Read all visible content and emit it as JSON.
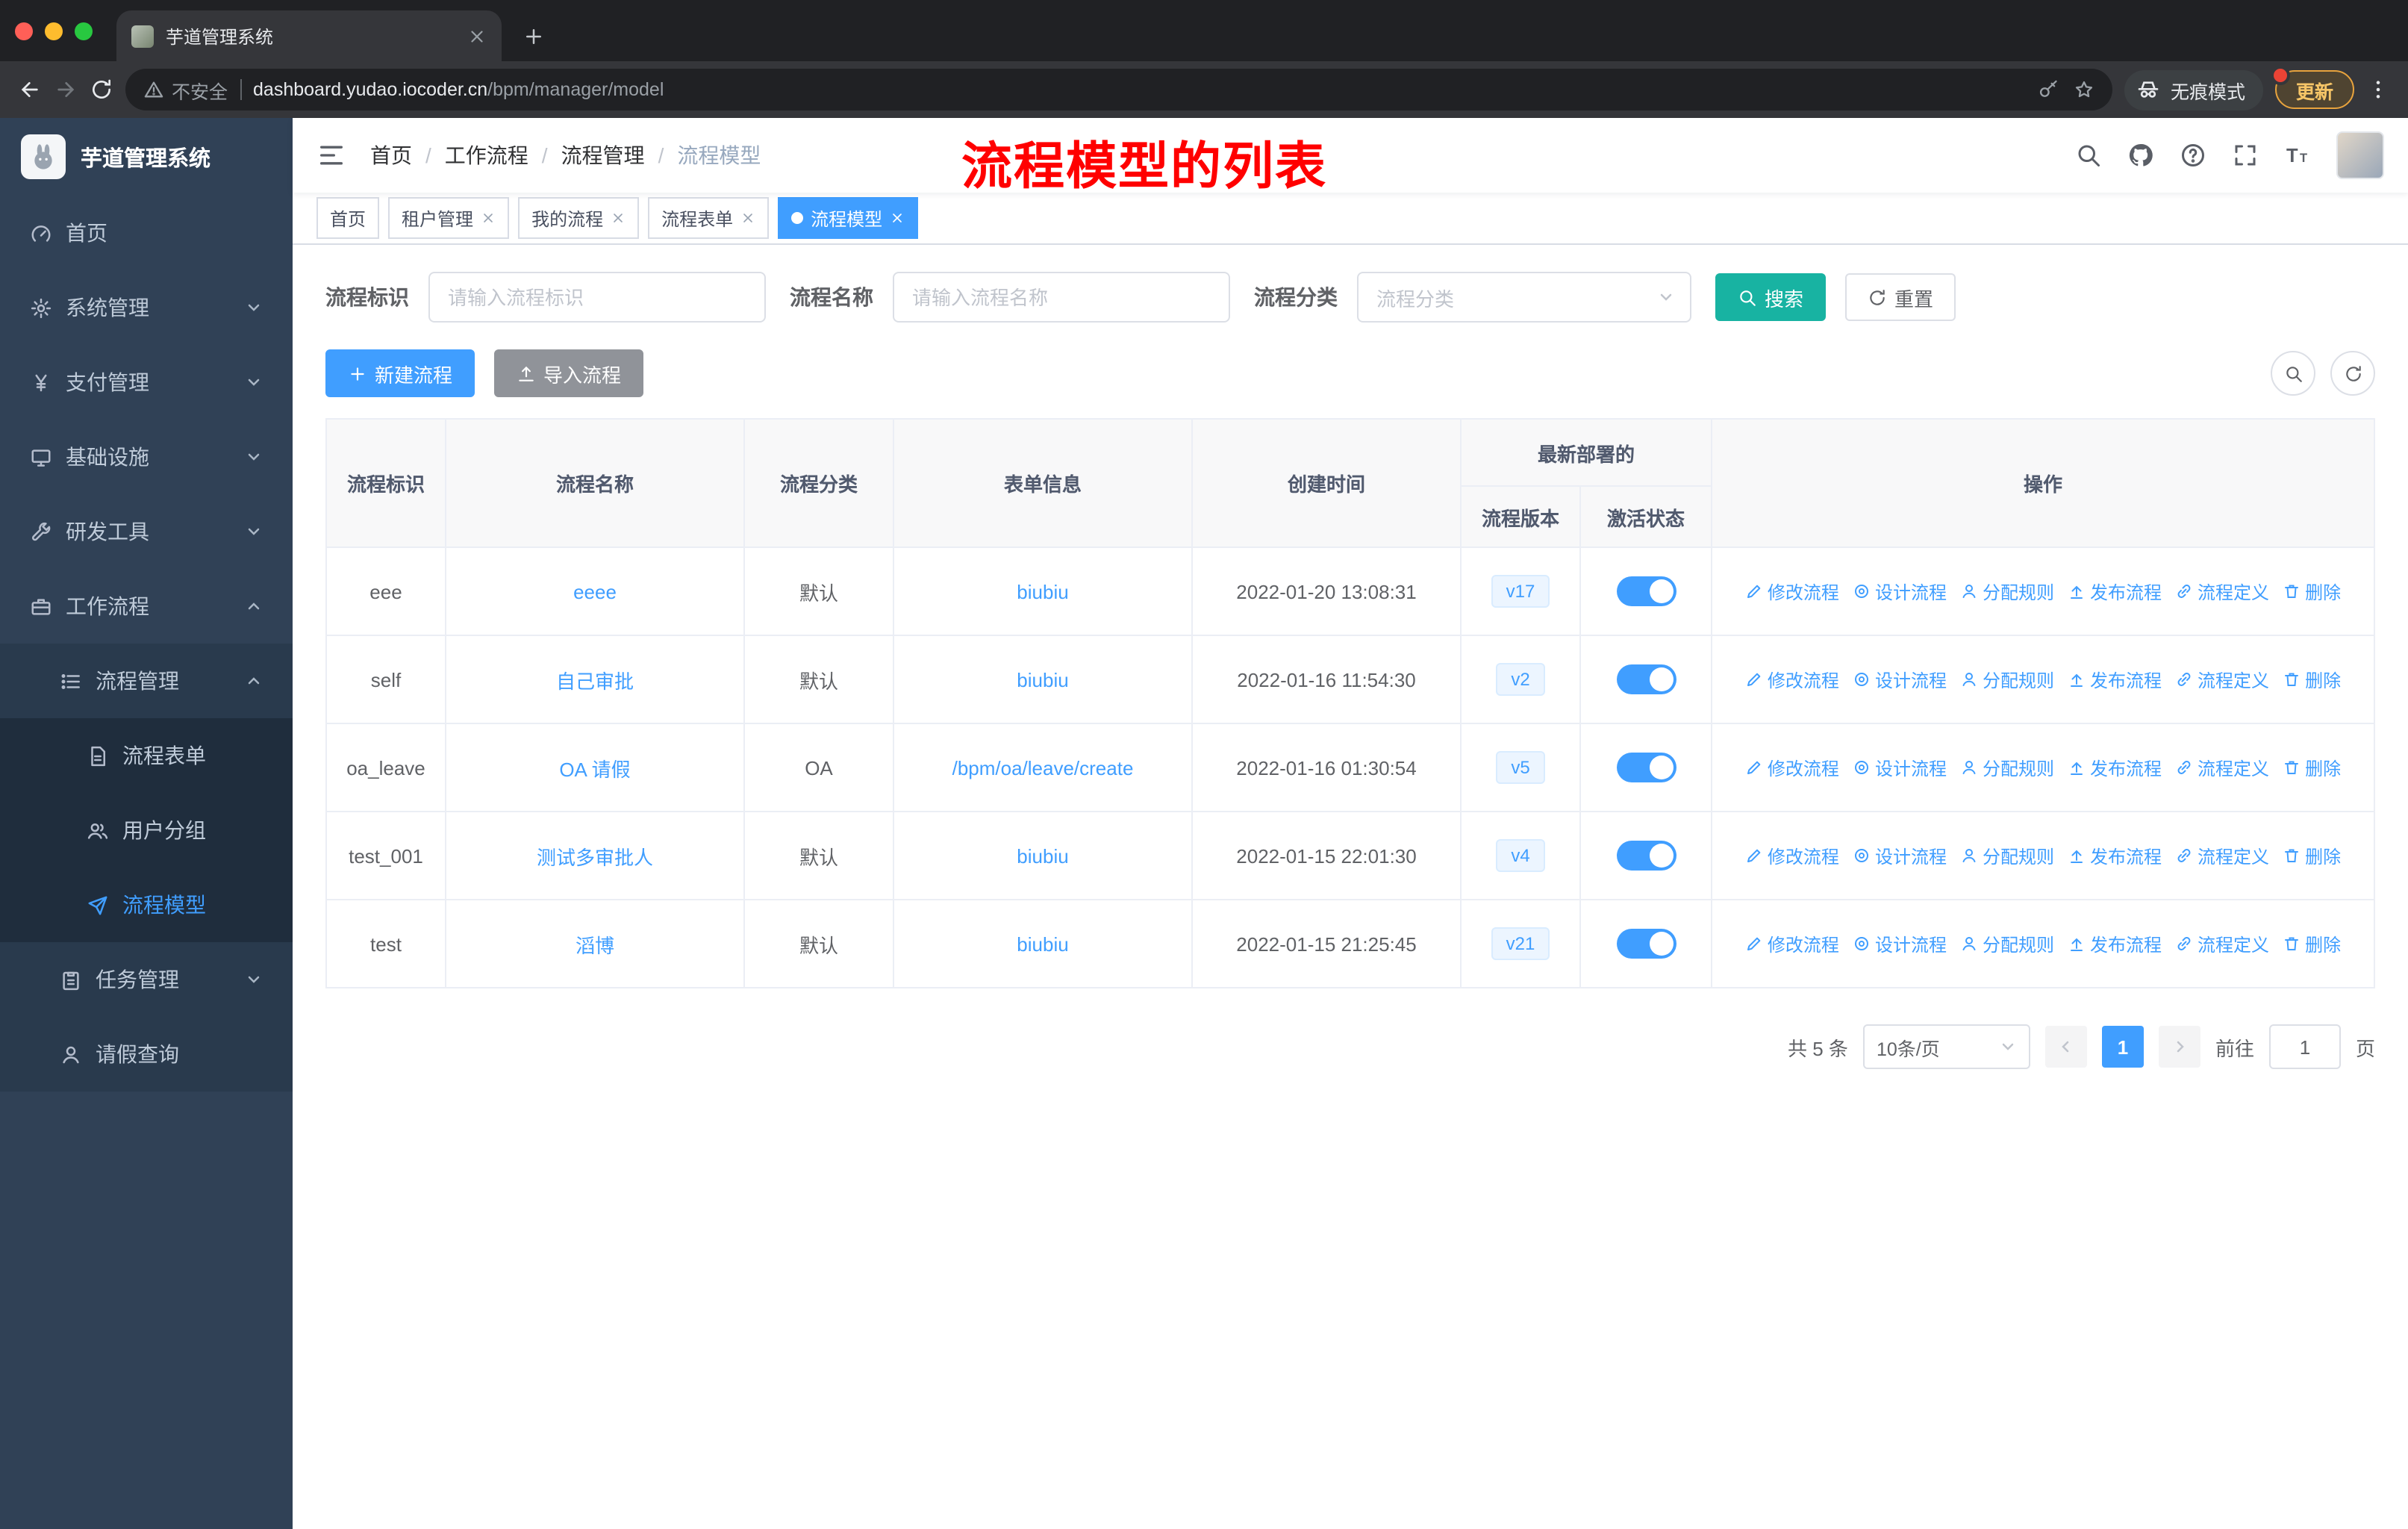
{
  "browser": {
    "tab_title": "芋道管理系统",
    "security_label": "不安全",
    "url_domain": "dashboard.yudao.iocoder.cn",
    "url_path": "/bpm/manager/model",
    "incognito_label": "无痕模式",
    "update_label": "更新"
  },
  "sidebar": {
    "logo_title": "芋道管理系统",
    "items": [
      {
        "key": "home",
        "label": "首页",
        "icon": "gauge",
        "depth": 0
      },
      {
        "key": "system",
        "label": "系统管理",
        "icon": "gear",
        "depth": 0,
        "arrow": "down"
      },
      {
        "key": "payment",
        "label": "支付管理",
        "icon": "yen",
        "depth": 0,
        "arrow": "down"
      },
      {
        "key": "infra",
        "label": "基础设施",
        "icon": "monitor",
        "depth": 0,
        "arrow": "down"
      },
      {
        "key": "devtools",
        "label": "研发工具",
        "icon": "wrench",
        "depth": 0,
        "arrow": "down"
      },
      {
        "key": "workflow",
        "label": "工作流程",
        "icon": "case",
        "depth": 0,
        "arrow": "up"
      },
      {
        "key": "process-mgmt",
        "label": "流程管理",
        "icon": "list",
        "depth": 1,
        "arrow": "up"
      },
      {
        "key": "process-form",
        "label": "流程表单",
        "icon": "doc",
        "depth": 2
      },
      {
        "key": "user-group",
        "label": "用户分组",
        "icon": "users",
        "depth": 2
      },
      {
        "key": "process-model",
        "label": "流程模型",
        "icon": "send",
        "depth": 2,
        "active": true
      },
      {
        "key": "task-mgmt",
        "label": "任务管理",
        "icon": "clipboard",
        "depth": 1,
        "arrow": "down"
      },
      {
        "key": "leave-query",
        "label": "请假查询",
        "icon": "user",
        "depth": 1
      }
    ]
  },
  "header": {
    "breadcrumb": [
      "首页",
      "工作流程",
      "流程管理",
      "流程模型"
    ],
    "annotation": "流程模型的列表"
  },
  "tags": [
    {
      "key": "home",
      "label": "首页",
      "closable": false,
      "active": false
    },
    {
      "key": "tenant",
      "label": "租户管理",
      "closable": true,
      "active": false
    },
    {
      "key": "my-process",
      "label": "我的流程",
      "closable": true,
      "active": false
    },
    {
      "key": "process-form",
      "label": "流程表单",
      "closable": true,
      "active": false
    },
    {
      "key": "process-model",
      "label": "流程模型",
      "closable": true,
      "active": true
    }
  ],
  "filters": {
    "key_label": "流程标识",
    "key_placeholder": "请输入流程标识",
    "name_label": "流程名称",
    "name_placeholder": "请输入流程名称",
    "category_label": "流程分类",
    "category_placeholder": "流程分类",
    "search_label": "搜索",
    "reset_label": "重置"
  },
  "toolbar": {
    "create_label": "新建流程",
    "import_label": "导入流程"
  },
  "table": {
    "columns": [
      "流程标识",
      "流程名称",
      "流程分类",
      "表单信息",
      "创建时间",
      "流程版本",
      "激活状态",
      "操作"
    ],
    "group_header": "最新部署的",
    "row_actions": [
      {
        "key": "edit",
        "label": "修改流程",
        "icon": "pen"
      },
      {
        "key": "design",
        "label": "设计流程",
        "icon": "target"
      },
      {
        "key": "assign",
        "label": "分配规则",
        "icon": "user"
      },
      {
        "key": "publish",
        "label": "发布流程",
        "icon": "publish"
      },
      {
        "key": "definition",
        "label": "流程定义",
        "icon": "link"
      },
      {
        "key": "delete",
        "label": "删除",
        "icon": "trash"
      }
    ],
    "rows": [
      {
        "key": "eee",
        "name": "eeee",
        "category": "默认",
        "form": "biubiu",
        "created": "2022-01-20 13:08:31",
        "version": "v17",
        "active": true
      },
      {
        "key": "self",
        "name": "自己审批",
        "category": "默认",
        "form": "biubiu",
        "created": "2022-01-16 11:54:30",
        "version": "v2",
        "active": true
      },
      {
        "key": "oa_leave",
        "name": "OA 请假",
        "category": "OA",
        "form": "/bpm/oa/leave/create",
        "created": "2022-01-16 01:30:54",
        "version": "v5",
        "active": true
      },
      {
        "key": "test_001",
        "name": "测试多审批人",
        "category": "默认",
        "form": "biubiu",
        "created": "2022-01-15 22:01:30",
        "version": "v4",
        "active": true
      },
      {
        "key": "test",
        "name": "滔博",
        "category": "默认",
        "form": "biubiu",
        "created": "2022-01-15 21:25:45",
        "version": "v21",
        "active": true
      }
    ]
  },
  "pagination": {
    "total": "共 5 条",
    "page_size": "10条/页",
    "page": "1",
    "goto_label": "前往",
    "goto_value": "1",
    "unit_label": "页"
  },
  "icons": {
    "browser": [
      "close-window-icon",
      "minimize-window-icon",
      "zoom-window-icon",
      "back-icon",
      "forward-icon",
      "reload-icon",
      "warning-icon",
      "key-icon",
      "star-icon",
      "incognito-icon",
      "kebab-menu-icon"
    ],
    "navbar": [
      "hamburger-icon",
      "search-icon",
      "github-icon",
      "help-icon",
      "fullscreen-icon",
      "font-size-icon"
    ],
    "colors": {
      "primary": "#409eff",
      "search_button": "#18b3a2",
      "annotation": "#ff0000",
      "sidebar_bg": "#304156"
    }
  }
}
